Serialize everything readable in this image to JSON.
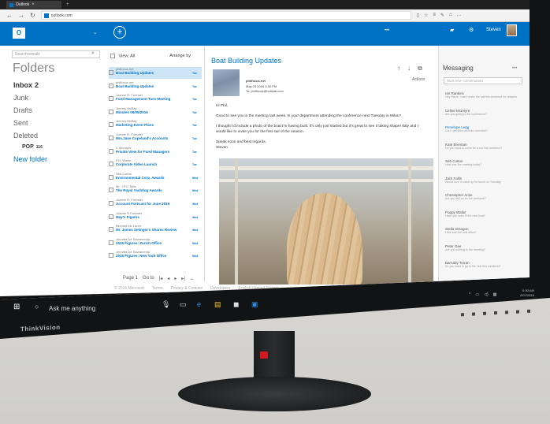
{
  "browser": {
    "tab_title": "Outlook",
    "url": "outlook.com"
  },
  "owa": {
    "logo": "O",
    "user_name": "Steven"
  },
  "folders": {
    "search_placeholder": "Search emails",
    "title": "Folders",
    "items": [
      {
        "label": "Inbox",
        "count": "2"
      },
      {
        "label": "Junk"
      },
      {
        "label": "Drafts"
      },
      {
        "label": "Sent"
      },
      {
        "label": "Deleted"
      },
      {
        "label": "POP",
        "count": "116"
      },
      {
        "label": "New folder"
      }
    ]
  },
  "list": {
    "view_all": "View: All",
    "arrange": "Arrange by",
    "messages": [
      {
        "sender": "philfocus.net",
        "subject": "Boat Building Updates",
        "date": "Tue"
      },
      {
        "sender": "philfocus.net",
        "subject": "Boat Building Updates",
        "date": "Tue"
      },
      {
        "sender": "Joanne R. Forester",
        "subject": "Fund Management Tues Meeting",
        "date": "Tue"
      },
      {
        "sender": "Jeremy McBay",
        "subject": "Minutes 06/05/2016",
        "date": "Tue"
      },
      {
        "sender": "Jeremy McBay",
        "subject": "Marketing Event Plans",
        "date": "Tue"
      },
      {
        "sender": "Joanne R. Forester",
        "subject": "Mrs.Jane Copeland's Accounts",
        "date": "Tue"
      },
      {
        "sender": "C.McIntyre",
        "subject": "Private View for Fund Managers",
        "date": "Tue"
      },
      {
        "sender": "P.H. Waller",
        "subject": "Corporate Video Launch",
        "date": "Tue"
      },
      {
        "sender": "Seb Cotton",
        "subject": "Environmental Corp. Awards",
        "date": "Wed"
      },
      {
        "sender": "Mr. J.P.C.Tallis",
        "subject": "The Royal Yachting Awards",
        "date": "Wed"
      },
      {
        "sender": "Joanne R. Forester",
        "subject": "Account Forecast for June 2016",
        "date": "Wed"
      },
      {
        "sender": "Joanne R.Forester",
        "subject": "May's Figures",
        "date": "Wed"
      },
      {
        "sender": "Bernard Mc Laren",
        "subject": "Mr. James Selinger's Shares Review",
        "date": "Wed"
      },
      {
        "sender": "Jennifer De Sacramento",
        "subject": "2016 Figures: Zurich Office",
        "date": "Wed"
      },
      {
        "sender": "Jennifer De Sacramento",
        "subject": "2016 Figures: New York Office",
        "date": "Wed"
      }
    ],
    "pager_label": "Page 1",
    "goto_label": "Go to"
  },
  "reading": {
    "subject": "Boat Building Updates",
    "actions_label": "Actions",
    "sender_name": "philfocus.net",
    "sent_date": "May 03 2016   3:30 PM",
    "to_line": "To: philfocus@hotmail.com",
    "greeting": "Hi Phil,",
    "paragraph_1": "Good to see you in the meeting last week. Is your department attending the conference next Tuesday in Milan?",
    "paragraph_2": "I thought I'd include a photo of the boat I'm having built. It's only just started but it's great to see it taking shape! Italy and I would like to invite you for the first sail of the season.",
    "signoff": "Speak soon and best regards,",
    "signature": "Steven"
  },
  "footer": {
    "links": [
      "© 2016 Microsoft",
      "Terms",
      "Privacy & Cookies",
      "Developers",
      "English (United States)"
    ]
  },
  "messaging": {
    "title": "Messaging",
    "more_icon": "more-dots",
    "start_placeholder": "Start new conversation",
    "contacts": [
      {
        "name": "Ian Rankins",
        "preview": "Hey Steve, I can't make the call this weekend for reasons",
        "highlight": false
      },
      {
        "name": "Celine McIntyre",
        "preview": "Are you going to the conference?",
        "highlight": false
      },
      {
        "name": "Penelope Legg",
        "preview": "Can I get your portfolio overview?",
        "highlight": true
      },
      {
        "name": "Kate Brennan",
        "preview": "Do you want to come for a run this weekend?",
        "highlight": false
      },
      {
        "name": "Seb Cotton",
        "preview": "How was the meeting today?",
        "highlight": false
      },
      {
        "name": "Jack Fallis",
        "preview": "Would love to catch up for lunch on Tuesday",
        "highlight": false
      },
      {
        "name": "Christopher Amie",
        "preview": "Are you still on for the weekend?",
        "highlight": false
      },
      {
        "name": "Poppy Waller",
        "preview": "Have you seen Phil's new boat?",
        "highlight": false
      },
      {
        "name": "Stella Octagon",
        "preview": "How was the new office?",
        "highlight": false
      },
      {
        "name": "Peter Gee",
        "preview": "Are you coming to the meeting?",
        "highlight": false
      },
      {
        "name": "Barnaby Torran",
        "preview": "Do you want to go to the club this weekend?",
        "highlight": false
      }
    ]
  },
  "taskbar": {
    "search_text": "Ask me anything",
    "time": "6:30 AM",
    "date": "2/07/2016"
  },
  "bezel": {
    "brand": "ThinkVision"
  }
}
